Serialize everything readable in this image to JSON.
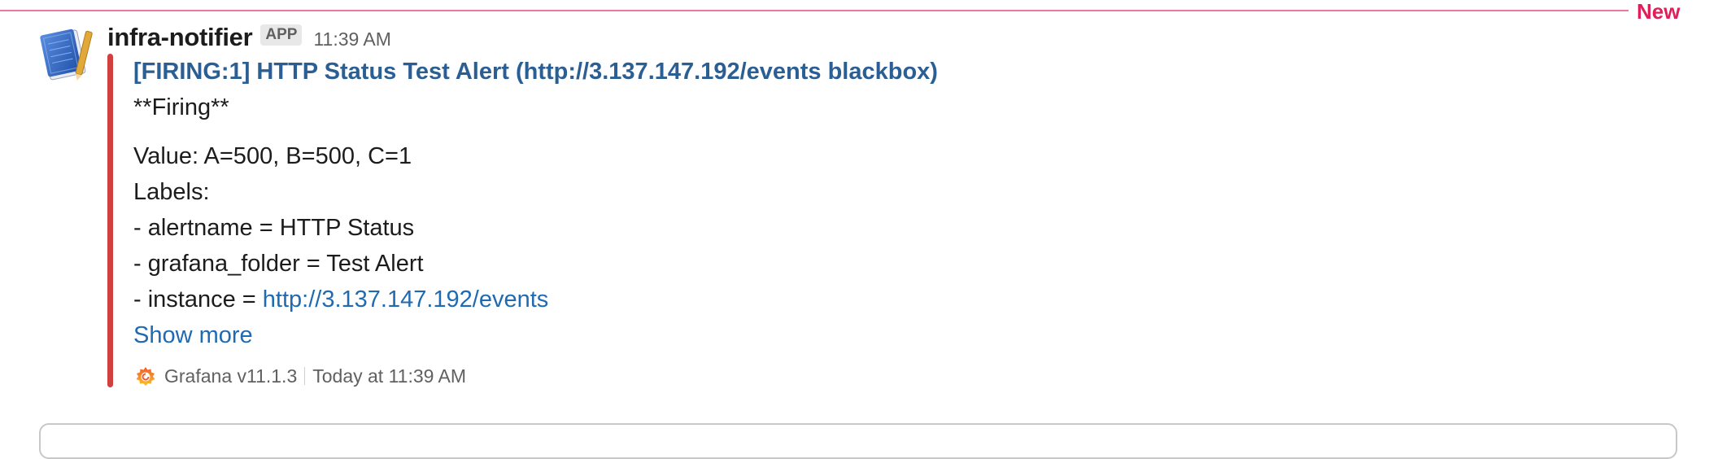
{
  "divider": {
    "label": "New",
    "color": "#e01e5a"
  },
  "message": {
    "sender": "infra-notifier",
    "badge": "APP",
    "time": "11:39 AM",
    "avatar_icon": "notebook-icon",
    "attachment": {
      "bar_color": "#d13f3f",
      "title": "[FIRING:1] HTTP Status Test Alert (http://3.137.147.192/events blackbox)",
      "status_line": "**Firing**",
      "value_line": "Value: A=500, B=500, C=1",
      "labels_header": "Labels:",
      "label_lines": [
        "- alertname = HTTP Status",
        "- grafana_folder = Test Alert"
      ],
      "instance_prefix": "- instance = ",
      "instance_link": "http://3.137.147.192/events",
      "show_more": "Show more",
      "footer": {
        "icon": "grafana-icon",
        "source": "Grafana v11.1.3",
        "timestamp": "Today at 11:39 AM"
      }
    }
  },
  "colors": {
    "link": "#1f6ab0",
    "title": "#2b5f94",
    "text": "#1d1c1d",
    "muted": "#616061"
  }
}
